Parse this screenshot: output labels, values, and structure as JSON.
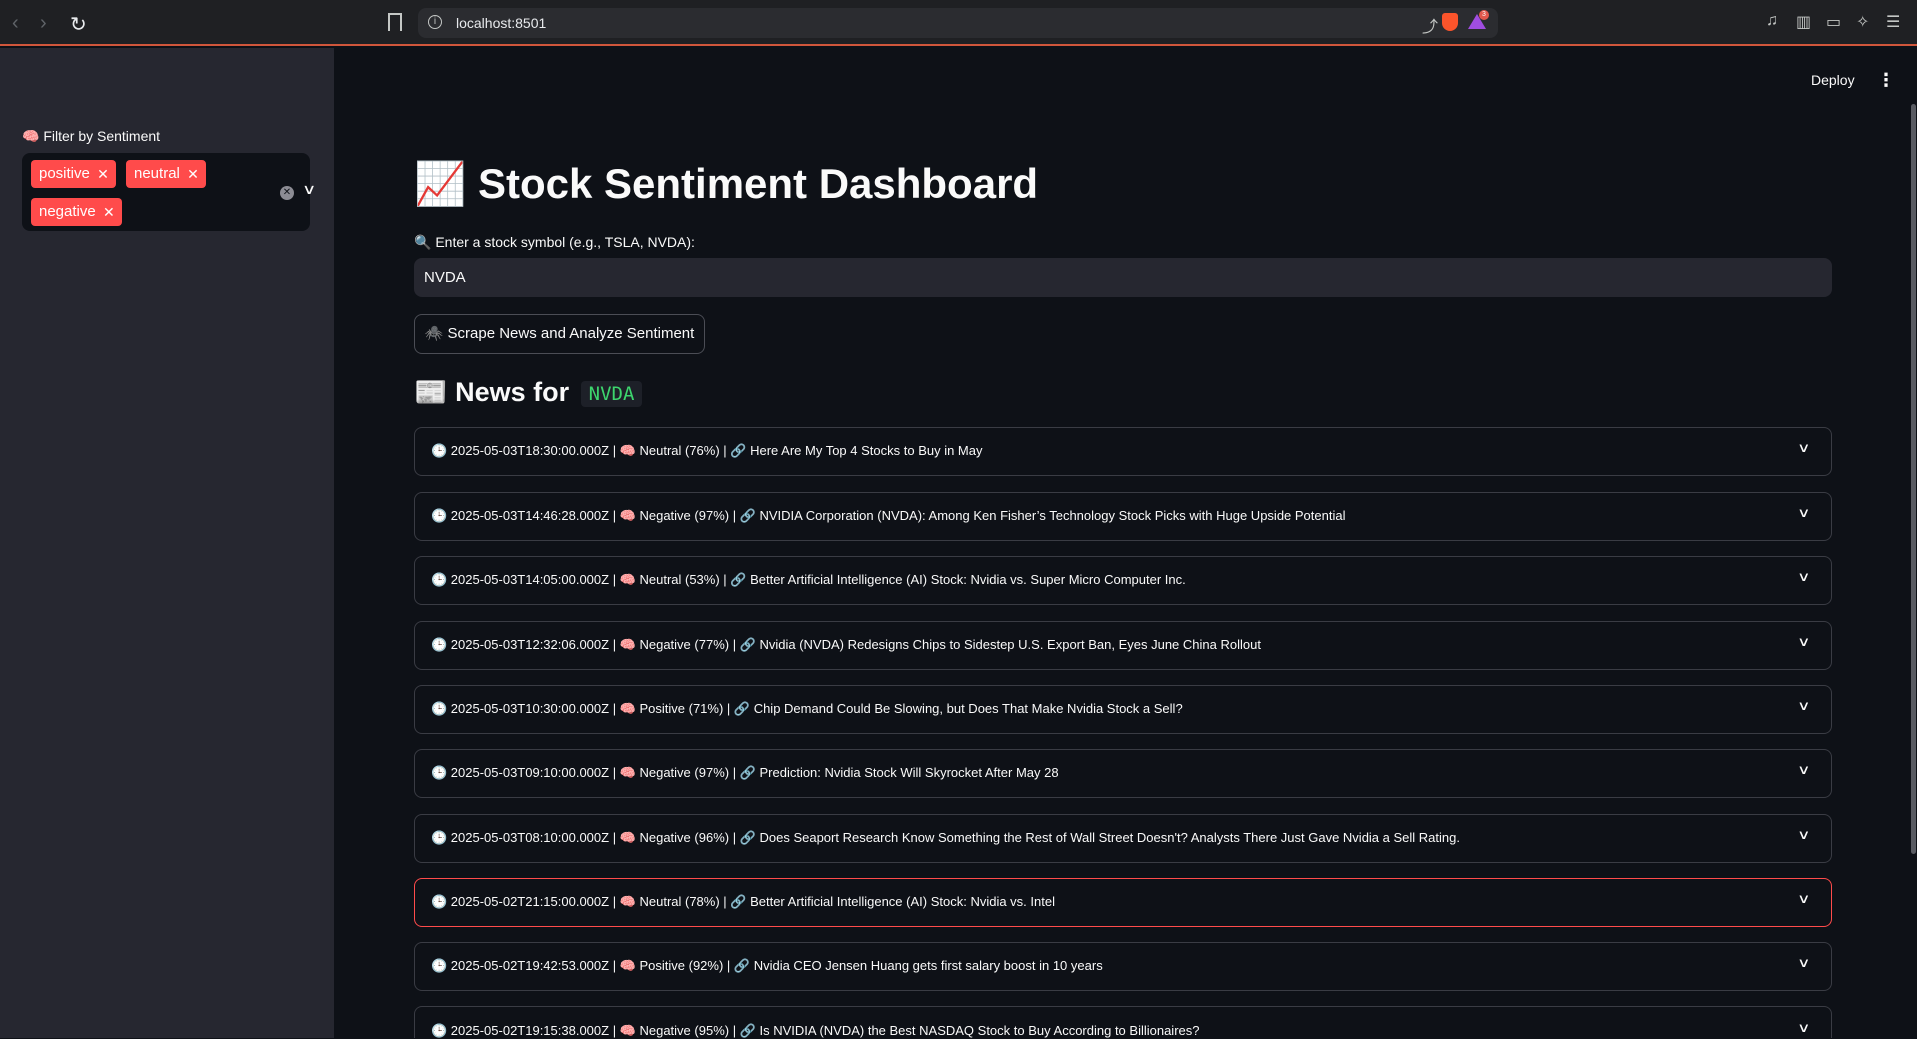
{
  "browser": {
    "url": "localhost:8501",
    "rewards_badge": "3"
  },
  "sidebar": {
    "filter_label": "🧠 Filter by Sentiment",
    "selected_tags": [
      "positive",
      "neutral",
      "negative"
    ]
  },
  "header": {
    "deploy_label": "Deploy"
  },
  "main": {
    "title": "📈 Stock Sentiment Dashboard",
    "input_label": "🔍 Enter a stock symbol (e.g., TSLA, NVDA):",
    "input_value": "NVDA",
    "button_label": "🕷️ Scrape News and Analyze Sentiment",
    "news_heading_prefix": "📰 News for",
    "news_symbol": "NVDA",
    "articles": [
      "🕒 2025-05-03T18:30:00.000Z | 🧠 Neutral (76%) | 🔗 Here Are My Top 4 Stocks to Buy in May",
      "🕒 2025-05-03T14:46:28.000Z | 🧠 Negative (97%) | 🔗 NVIDIA Corporation (NVDA): Among Ken Fisher’s Technology Stock Picks with Huge Upside Potential",
      "🕒 2025-05-03T14:05:00.000Z | 🧠 Neutral (53%) | 🔗 Better Artificial Intelligence (AI) Stock: Nvidia vs. Super Micro Computer Inc.",
      "🕒 2025-05-03T12:32:06.000Z | 🧠 Negative (77%) | 🔗 Nvidia (NVDA) Redesigns Chips to Sidestep U.S. Export Ban, Eyes June China Rollout",
      "🕒 2025-05-03T10:30:00.000Z | 🧠 Positive (71%) | 🔗 Chip Demand Could Be Slowing, but Does That Make Nvidia Stock a Sell?",
      "🕒 2025-05-03T09:10:00.000Z | 🧠 Negative (97%) | 🔗 Prediction: Nvidia Stock Will Skyrocket After May 28",
      "🕒 2025-05-03T08:10:00.000Z | 🧠 Negative (96%) | 🔗 Does Seaport Research Know Something the Rest of Wall Street Doesn't? Analysts There Just Gave Nvidia a Sell Rating.",
      "🕒 2025-05-02T21:15:00.000Z | 🧠 Neutral (78%) | 🔗 Better Artificial Intelligence (AI) Stock: Nvidia vs. Intel",
      "🕒 2025-05-02T19:42:53.000Z | 🧠 Positive (92%) | 🔗 Nvidia CEO Jensen Huang gets first salary boost in 10 years",
      "🕒 2025-05-02T19:15:38.000Z | 🧠 Negative (95%) | 🔗 Is NVIDIA (NVDA) the Best NASDAQ Stock to Buy According to Billionaires?"
    ]
  }
}
